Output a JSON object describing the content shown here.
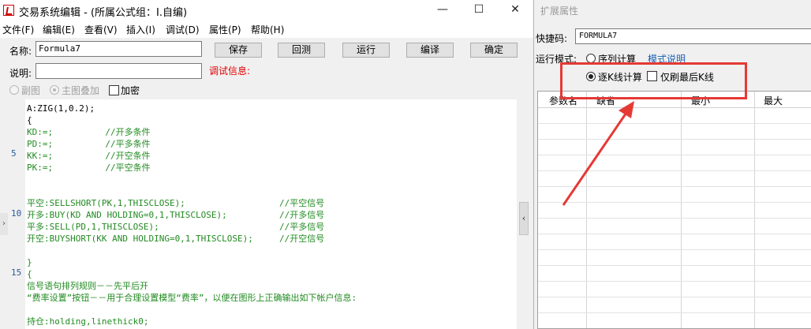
{
  "window": {
    "title": "交易系统编辑 - (所属公式组：I.自编)",
    "controls": [
      "—",
      "☐",
      "✕"
    ]
  },
  "menu": [
    "文件(F)",
    "编辑(E)",
    "查看(V)",
    "插入(I)",
    "调试(D)",
    "属性(P)",
    "帮助(H)"
  ],
  "form": {
    "name_label": "名称:",
    "name_value": "Formula7",
    "desc_label": "说明:",
    "desc_value": "",
    "debug_label": "调试信息:"
  },
  "buttons": [
    "保存",
    "回测",
    "运行",
    "编译",
    "确定"
  ],
  "options": {
    "sub_chart": "副图",
    "main_overlay": "主图叠加",
    "encrypt": "加密"
  },
  "editor": {
    "line_numbers": [
      "5",
      "10",
      "15"
    ],
    "lines": [
      {
        "text": "A:ZIG(1,0.2);",
        "color": "#000000"
      },
      {
        "text": "{",
        "color": "#000000"
      },
      {
        "text": "KD:=;          //开多条件",
        "color": "#228b22"
      },
      {
        "text": "PD:=;          //平多条件",
        "color": "#228b22"
      },
      {
        "text": "KK:=;          //开空条件",
        "color": "#228b22"
      },
      {
        "text": "PK:=;          //平空条件",
        "color": "#228b22"
      },
      {
        "text": "",
        "color": "#000000"
      },
      {
        "text": "",
        "color": "#000000"
      },
      {
        "text": "平空:SELLSHORT(PK,1,THISCLOSE);                  //平空信号",
        "color": "#228b22"
      },
      {
        "text": "开多:BUY(KD AND HOLDING=0,1,THISCLOSE);          //开多信号",
        "color": "#228b22"
      },
      {
        "text": "平多:SELL(PD,1,THISCLOSE);                       //平多信号",
        "color": "#228b22"
      },
      {
        "text": "开空:BUYSHORT(KK AND HOLDING=0,1,THISCLOSE);     //开空信号",
        "color": "#228b22"
      },
      {
        "text": "",
        "color": "#000000"
      },
      {
        "text": "}",
        "color": "#228b22"
      },
      {
        "text": "{",
        "color": "#228b22"
      },
      {
        "text": "信号语句排列规则－－先平后开",
        "color": "#228b22"
      },
      {
        "text": "“费率设置”按钮－－用于合理设置模型“费率”，以便在图形上正确输出如下帐户信息:",
        "color": "#228b22"
      },
      {
        "text": "",
        "color": "#000000"
      },
      {
        "text": "持仓:holding,linethick0;",
        "color": "#228b22"
      }
    ]
  },
  "panel": {
    "title": "扩展属性",
    "hotkey_label": "快捷码:",
    "hotkey_value": "FORMULA7",
    "mode_label": "运行模式:",
    "mode_option1": "序列计算",
    "mode_explain": "模式说明",
    "mode_option2": "逐K线计算",
    "only_last_bar": "仅刷最后K线",
    "table_headers": [
      "参数名",
      "缺省",
      "最小",
      "最大"
    ]
  },
  "colors": {
    "annotation_red": "#e53935",
    "link_blue": "#1a5fb4",
    "debug_red": "#e00000",
    "code_green": "#228b22"
  }
}
